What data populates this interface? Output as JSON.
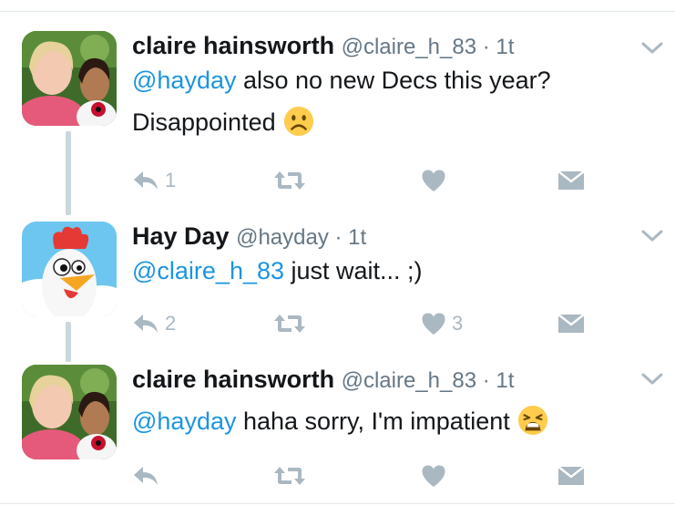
{
  "tweets": [
    {
      "name": "claire hainsworth",
      "handle": "@claire_h_83 · 1t",
      "mention": "@hayday",
      "text_line1": " also no new Decs this year?",
      "text_line2": "Disappointed",
      "emoji": "frowning-face",
      "replies": "1",
      "likes": ""
    },
    {
      "name": "Hay Day",
      "handle": "@hayday · 1t",
      "mention": "@claire_h_83",
      "text_line1": " just wait... ;)",
      "replies": "2",
      "likes": "3"
    },
    {
      "name": "claire hainsworth",
      "handle": "@claire_h_83 · 1t",
      "mention": "@hayday",
      "text_line1": " haha sorry, I'm impatient",
      "emoji": "weary-face",
      "replies": "",
      "likes": ""
    }
  ],
  "colors": {
    "mention": "#1b95e0",
    "icon": "#aab8c2",
    "divider": "#e1e8ed",
    "thread_line": "#ccd6dd"
  }
}
